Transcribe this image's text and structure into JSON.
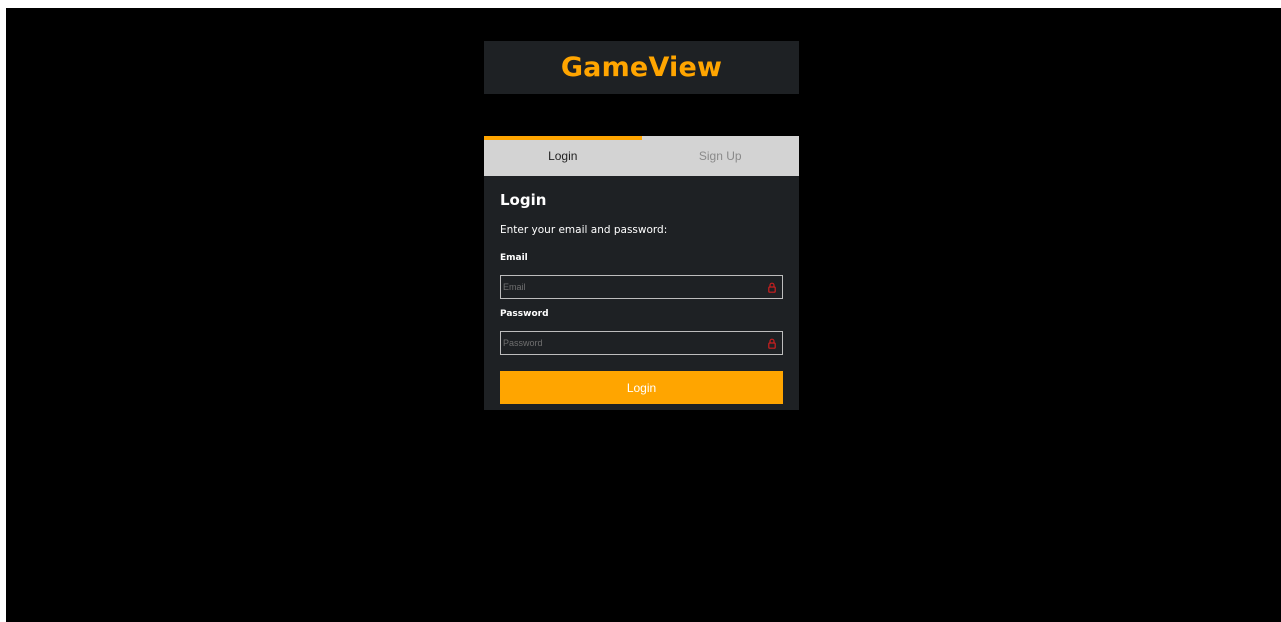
{
  "app": {
    "brand": "GameView"
  },
  "tabs": [
    {
      "label": "Login",
      "active": true
    },
    {
      "label": "Sign Up",
      "active": false
    }
  ],
  "login_form": {
    "heading": "Login",
    "instruction": "Enter your email and password:",
    "email": {
      "label": "Email",
      "placeholder": "Email",
      "value": "",
      "icon": "lock-icon"
    },
    "password": {
      "label": "Password",
      "placeholder": "Password",
      "value": "",
      "icon": "lock-icon"
    },
    "submit_label": "Login"
  },
  "colors": {
    "accent": "#ffa500",
    "panel": "#1e2124",
    "background": "#000000",
    "tab_bar": "#d3d3d3",
    "error_icon": "#cc1f1f"
  }
}
